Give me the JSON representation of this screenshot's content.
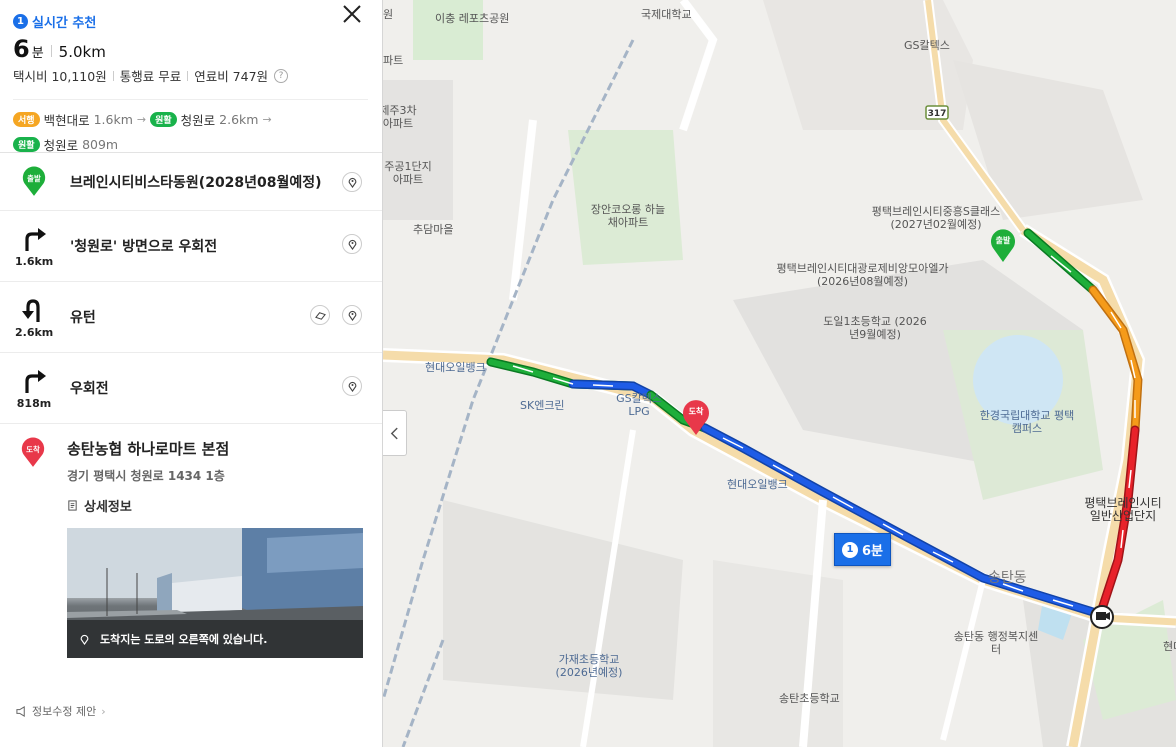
{
  "route_summary": {
    "rec_num": "1",
    "rec_label": "실시간 추천",
    "time_value": "6",
    "time_unit": "분",
    "distance": "5.0km",
    "taxi": "택시비 10,110원",
    "toll": "통행료 무료",
    "fuel": "연료비 747원",
    "help": "?",
    "roads": [
      {
        "tag": "서행",
        "name": "백현대로",
        "dist": "1.6km"
      },
      {
        "tag": "원활",
        "name": "청원로",
        "dist": "2.6km"
      },
      {
        "tag": "원활",
        "name": "청원로",
        "dist": "809m"
      }
    ]
  },
  "steps": [
    {
      "kind": "출발",
      "label": "브레인시티비스타동원(2028년08월예정)"
    },
    {
      "kind": "right-turn",
      "dist": "1.6km",
      "label": "'청원로' 방면으로 우회전"
    },
    {
      "kind": "u-turn",
      "dist": "2.6km",
      "label": "유턴"
    },
    {
      "kind": "right-turn",
      "dist": "818m",
      "label": "우회전"
    }
  ],
  "destination": {
    "badge": "도착",
    "title": "송탄농협 하나로마트 본점",
    "address": "경기 평택시 청원로 1434 1층",
    "detail": "상세정보",
    "street_caption": "도착지는 도로의 오른쪽에 있습니다."
  },
  "footer": "정보수정 제안",
  "colors": {
    "accent": "#1a6fe8",
    "route_blue": "#1e5ce6",
    "route_green": "#1eae3a",
    "route_orange": "#f59b1a",
    "route_red": "#e8222a",
    "dest_red": "#e8384a"
  },
  "map": {
    "start_badge": "출발",
    "end_badge": "도착",
    "time_badge_num": "1",
    "time_badge_label": "6분",
    "road_shield": "317",
    "labels": [
      "이충 레포츠공원",
      "국제대학교",
      "GS칼텍스",
      "파트",
      "제주3차 아파트",
      "주공1단지 아파트",
      "추담마을",
      "장안코오롱 하늘채아파트",
      "평택브레인시티중흥S클래스 (2027년02월예정)",
      "평택브레인시티대광로제비앙모아엘가 (2026년08월예정)",
      "도일1초등학교 (2026년9월예정)",
      "현대오일뱅크",
      "SK엔크린",
      "GS칼텍스 LPG",
      "한경국립대학교 평택캠퍼스",
      "평택브레인시티 일반산업단지",
      "송탄동",
      "송탄동 행정복지센터",
      "가재초등학교 (2026년예정)",
      "송탄초등학교",
      "현대오일뱅크",
      "현대",
      "원"
    ]
  }
}
